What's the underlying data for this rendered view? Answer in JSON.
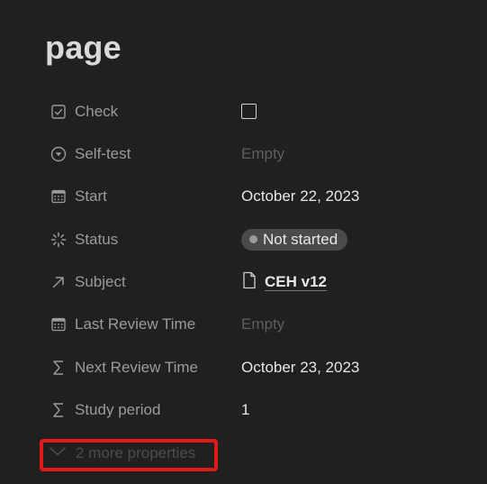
{
  "page": {
    "title": "page"
  },
  "properties": [
    {
      "label": "Check",
      "icon": "checkbox-icon",
      "value_type": "checkbox",
      "checked": false
    },
    {
      "label": "Self-test",
      "icon": "select-circle-icon",
      "value_type": "empty",
      "value": "Empty"
    },
    {
      "label": "Start",
      "icon": "calendar-icon",
      "value_type": "text",
      "value": "October 22, 2023"
    },
    {
      "label": "Status",
      "icon": "status-spinner-icon",
      "value_type": "status",
      "value": "Not started"
    },
    {
      "label": "Subject",
      "icon": "relation-arrow-icon",
      "value_type": "relation",
      "value": "CEH v12"
    },
    {
      "label": "Last Review Time",
      "icon": "calendar-icon",
      "value_type": "empty",
      "value": "Empty"
    },
    {
      "label": "Next Review Time",
      "icon": "sigma-icon",
      "value_type": "text",
      "value": "October 23, 2023"
    },
    {
      "label": "Study period",
      "icon": "sigma-icon",
      "value_type": "text",
      "value": "1"
    }
  ],
  "more_properties": {
    "label": "2 more properties",
    "icon": "chevron-down-icon"
  },
  "colors": {
    "background": "#202020",
    "label": "#9b9b9b",
    "value": "#e6e6e6",
    "empty": "#5e5e5e",
    "status_pill": "#4a4a4a",
    "highlight": "#e11919"
  }
}
